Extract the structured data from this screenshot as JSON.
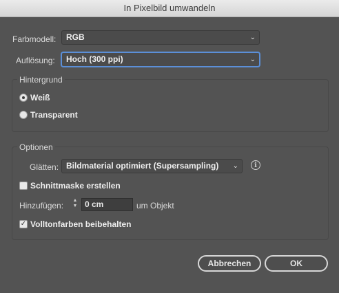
{
  "window": {
    "title": "In Pixelbild umwandeln"
  },
  "color_model": {
    "label": "Farbmodell:",
    "value": "RGB"
  },
  "resolution": {
    "label": "Auflösung:",
    "value": "Hoch (300 ppi)"
  },
  "background": {
    "title": "Hintergrund",
    "options": [
      {
        "label": "Weiß",
        "selected": true
      },
      {
        "label": "Transparent",
        "selected": false
      }
    ]
  },
  "options": {
    "title": "Optionen",
    "smoothing_label": "Glätten:",
    "smoothing_value": "Bildmaterial optimiert (Supersampling)",
    "clipping_mask_label": "Schnittmaske erstellen",
    "clipping_mask_checked": false,
    "add_label": "Hinzufügen:",
    "add_value": "0 cm",
    "add_suffix": "um Objekt",
    "keep_spot_label": "Volltonfarben beibehalten",
    "keep_spot_checked": true
  },
  "buttons": {
    "cancel": "Abbrechen",
    "ok": "OK"
  },
  "icons": {
    "info": "info-icon",
    "chevron": "chevron-down-icon",
    "stepper": "stepper-icon"
  }
}
